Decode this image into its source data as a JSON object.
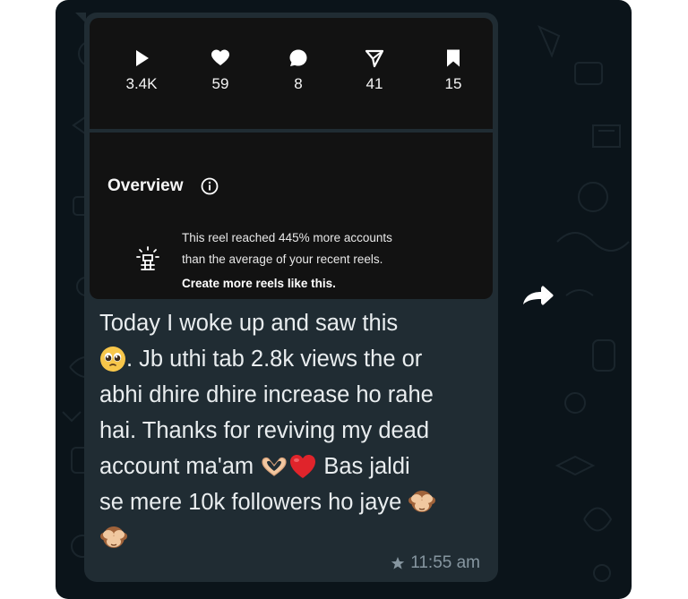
{
  "stats": [
    {
      "icon": "play-icon",
      "value": "3.4K"
    },
    {
      "icon": "heart-icon",
      "value": "59"
    },
    {
      "icon": "comment-icon",
      "value": "8"
    },
    {
      "icon": "share-icon",
      "value": "41"
    },
    {
      "icon": "bookmark-icon",
      "value": "15"
    }
  ],
  "overview": {
    "title": "Overview",
    "tip_line1": "This reel reached 445% more accounts",
    "tip_line2": "than the average of your recent reels.",
    "tip_link": "Create more reels like this."
  },
  "message": {
    "line1": "Today I woke up and saw this",
    "line2": ". Jb uthi tab 2.8k views the or",
    "line3": "abhi dhire dhire increase ho rahe",
    "line4": "hai. Thanks for reviving my dead",
    "line5a": "account ma'am",
    "line5b": "Bas jaldi",
    "line6": "se mere 10k followers ho jaye",
    "time": "11:55 am",
    "starred": true
  },
  "colors": {
    "chat_background": "#0b141a",
    "bubble": "#202c33",
    "screenshot_card": "#121212",
    "message_text": "#e9edef",
    "meta_text": "#8696a0"
  }
}
